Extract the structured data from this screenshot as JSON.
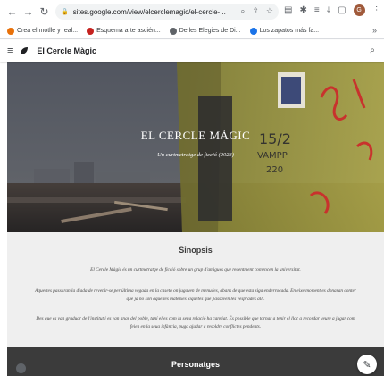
{
  "browser": {
    "url": "sites.google.com/view/elcerclemagic/el-cercle-...",
    "bookmarks": [
      {
        "label": "Crea el motlle y real...",
        "color": "#e8710a"
      },
      {
        "label": "Esquema arte ascién...",
        "color": "#c5221f"
      },
      {
        "label": "De les Elegies de Di...",
        "color": "#5f6368"
      },
      {
        "label": "Los zapatos más fa...",
        "color": "#1a73e8"
      }
    ]
  },
  "site": {
    "title": "El Cercle Màgic"
  },
  "hero": {
    "title": "EL CERCLE MÀGIC",
    "subtitle": "Un curtmetratge de ficció (2023)",
    "graffiti": "15/2 VAMPP 220"
  },
  "sinopsis": {
    "title": "Sinopsis",
    "paragraphs": [
      "El Cercle Màgic és un curtmetratge de ficció sobre un grup d'amigues que recentment comencen la universitat.",
      "Aquestes passaran la diada de revenir-se per última vegada en la caseta on jugaven de menudes, abans de que esta siga enderrocada. En eixe moment es donaran conter que ja no són aquelles mateixes xiquetes que passaven les vesprades allí.",
      "Des que es van graduar de l'institut i es van anar del poble, taní elles com la seua relació ha canviat. És possible que tornar a tenir el lloc a recordar veure a jugar com feien en la seua infància, puga ajudar a resoldre conflictes pendents."
    ]
  },
  "personatges": {
    "title": "Personatges"
  }
}
